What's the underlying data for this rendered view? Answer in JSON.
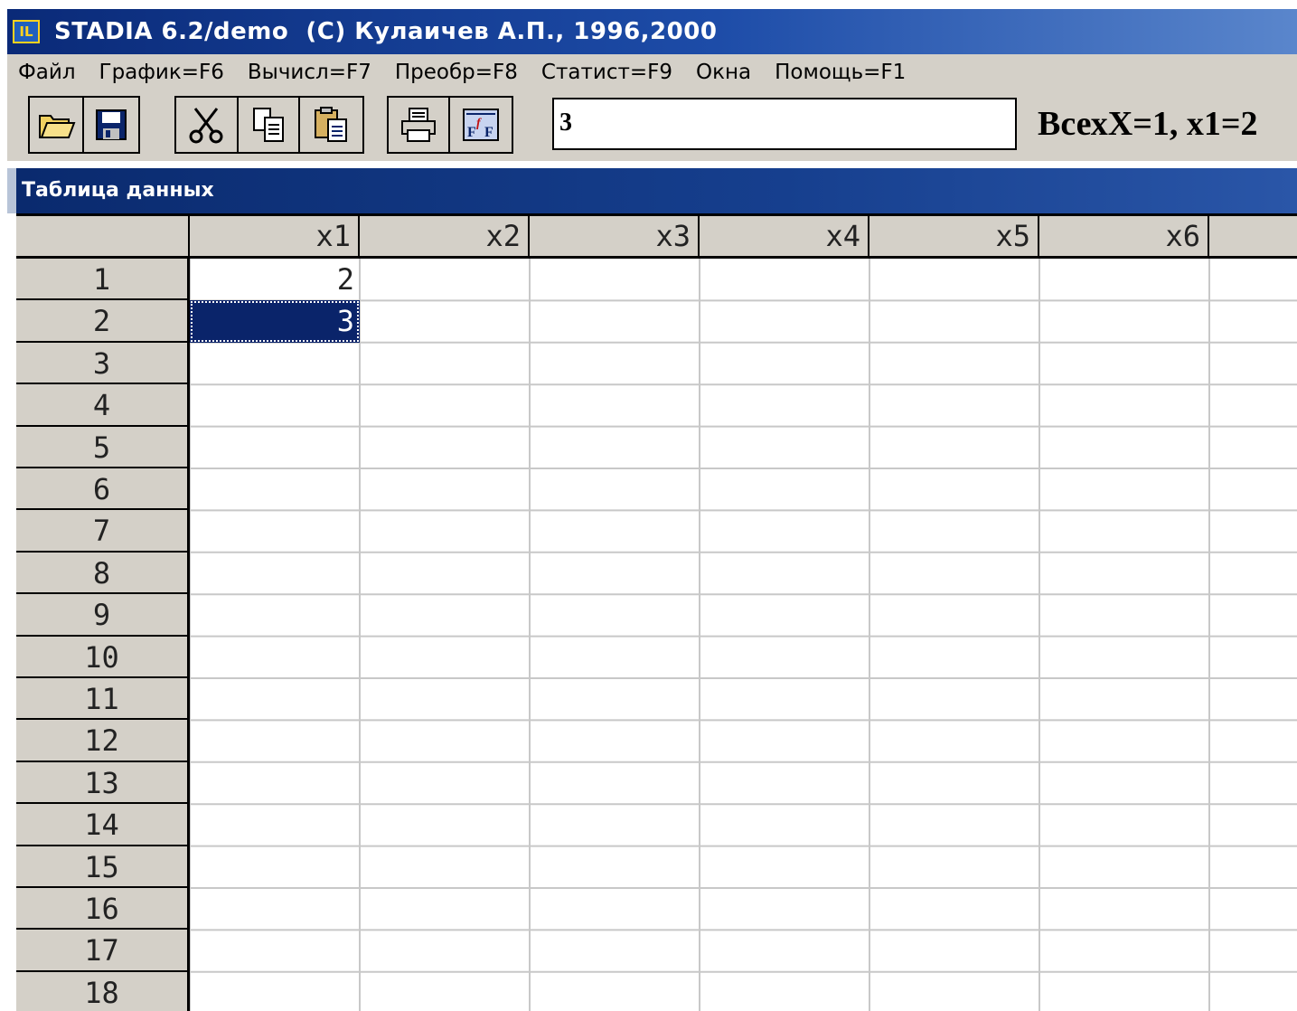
{
  "window": {
    "title": "STADIA 6.2/demo  (C) Кулаичев А.П., 1996,2000",
    "icon_label": "IL"
  },
  "menu": [
    "Файл",
    "График=F6",
    "Вычисл=F7",
    "Преобр=F8",
    "Статист=F9",
    "Окна",
    "Помощь=F1"
  ],
  "toolbar": {
    "buttons": [
      "open-folder-icon",
      "save-disk-icon",
      "cut-scissors-icon",
      "copy-icon",
      "paste-icon",
      "print-icon",
      "formula-icon"
    ],
    "cell_editor_value": "3",
    "status": "ВсехX=1, x1=2"
  },
  "table": {
    "title": "Таблица данных",
    "columns": [
      "x1",
      "x2",
      "x3",
      "x4",
      "x5",
      "x6"
    ],
    "rows": [
      "1",
      "2",
      "3",
      "4",
      "5",
      "6",
      "7",
      "8",
      "9",
      "10",
      "11",
      "12",
      "13",
      "14",
      "15",
      "16",
      "17",
      "18"
    ],
    "cells": [
      {
        "row": 1,
        "col": 1,
        "value": "2"
      },
      {
        "row": 2,
        "col": 1,
        "value": "3",
        "selected": true
      }
    ]
  },
  "colors": {
    "titlebar": "#0a2a78",
    "window_face": "#d4d0c8",
    "selection": "#0a246a"
  }
}
